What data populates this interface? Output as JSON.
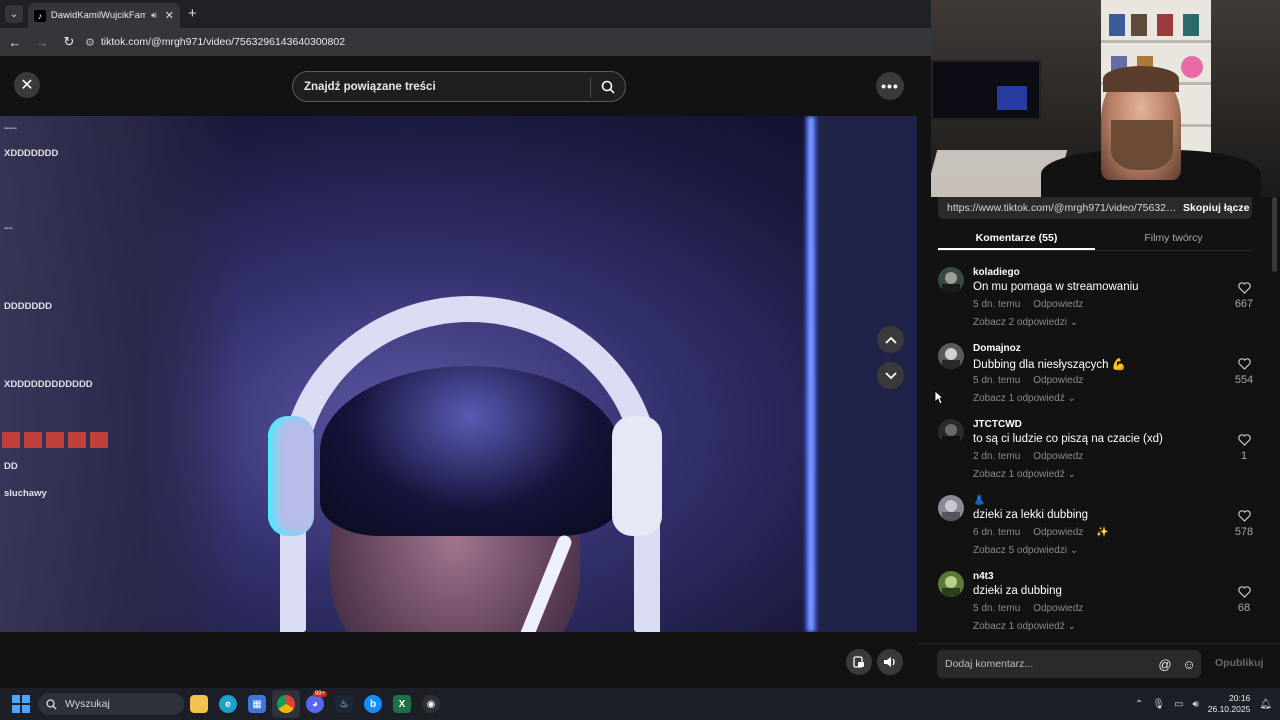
{
  "browser": {
    "tab_title": "DawidKamilWujcikFameMma",
    "url": "tiktok.com/@mrgh971/video/7563296143640300802"
  },
  "tiktok": {
    "search_placeholder": "Znajdź powiązane treści",
    "share_url": "https://www.tiktok.com/@mrgh971/video/756329...",
    "copy_label": "Skopiuj łącze",
    "tabs": [
      {
        "label": "Komentarze (55)",
        "active": true
      },
      {
        "label": "Filmy twórcy",
        "active": false
      }
    ],
    "comments": [
      {
        "user": "koladiego",
        "text": "On mu pomaga w streamowaniu",
        "time": "5 dn. temu",
        "reply": "Odpowiedz",
        "replies": "Zobacz 2 odpowiedzi",
        "likes": "667",
        "avatar_color": "#3a4a3a"
      },
      {
        "user": "Domajnoz",
        "text": "Dubbing dla niesłyszących 💪",
        "time": "5 dn. temu",
        "reply": "Odpowiedz",
        "replies": "Zobacz 1 odpowiedź",
        "likes": "554",
        "avatar_color": "#5a5a5a"
      },
      {
        "user": "JTCTCWD",
        "text": "to są ci ludzie co piszą na czacie (xd)",
        "time": "2 dn. temu",
        "reply": "Odpowiedz",
        "replies": "Zobacz 1 odpowiedź",
        "likes": "1",
        "avatar_color": "#2a2a2a"
      },
      {
        "user": "👗",
        "text": "dzieki za lekki dubbing",
        "time": "6 dn. temu",
        "reply": "Odpowiedz",
        "replies": "Zobacz 5 odpowiedzi",
        "likes": "578",
        "avatar_color": "#8a8a95"
      },
      {
        "user": "n4t3",
        "text": "dzieki za dubbing",
        "time": "5 dn. temu",
        "reply": "Odpowiedz",
        "replies": "Zobacz 1 odpowiedź",
        "likes": "68",
        "avatar_color": "#5b7a3a"
      }
    ],
    "comment_placeholder": "Dodaj komentarz...",
    "publish_label": "Opublikuj"
  },
  "video_overlay_chat": [
    "XDDDDDDD",
    "DDDDDDD",
    "XDDDDDDDDDDDD",
    "DD",
    "sluchawy"
  ],
  "taskbar": {
    "search_label": "Wyszukaj",
    "time": "20:16",
    "date": "26.10.2025",
    "discord_badge": "99+"
  },
  "colors": {
    "accent_blue": "#4aa6ff",
    "tiktok_bg": "#121212"
  }
}
